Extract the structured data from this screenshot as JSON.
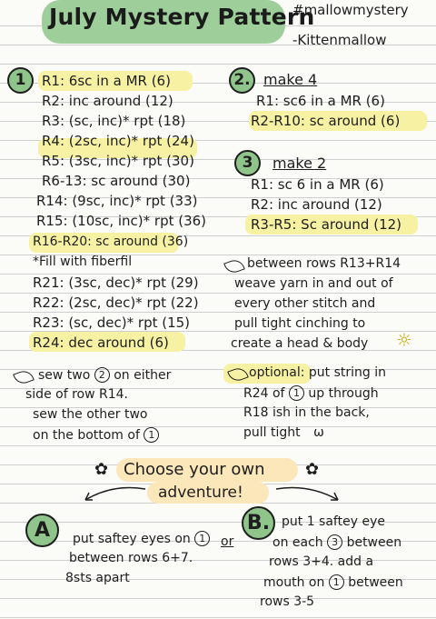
{
  "header": {
    "title": "July Mystery Pattern",
    "hashtag": "#mallowmystery",
    "author": "-Kittenmallow"
  },
  "part1": {
    "number": "1",
    "rows": [
      "R1: 6sc in a MR (6)",
      "R2: inc around (12)",
      "R3: (sc, inc)* rpt (18)",
      "R4: (2sc, inc)* rpt (24)",
      "R5: (3sc, inc)* rpt (30)",
      "R6-13: sc around (30)",
      "R14: (9sc, inc)* rpt (33)",
      "R15: (10sc, inc)* rpt (36)",
      "R16-R20: sc around (36)",
      "*Fill with fiberfil",
      "R21: (3sc, dec)* rpt (29)",
      "R22: (2sc, dec)* rpt (22)",
      "R23: (sc, dec)* rpt (15)",
      "R24: dec around (6)"
    ]
  },
  "part2": {
    "number": "2.",
    "heading": "make 4",
    "rows": [
      "R1: sc6 in a MR (6)",
      "R2-R10: sc around (6)"
    ]
  },
  "part3": {
    "number": "3",
    "heading": "make 2",
    "rows": [
      "R1: sc 6 in a MR (6)",
      "R2: inc around (12)",
      "R3-R5: Sc around (12)"
    ]
  },
  "note_head": {
    "lines": [
      "between rows R13+R14",
      "weave yarn in and out of",
      "every other stitch and",
      "pull tight cinching to",
      "create a head & body"
    ]
  },
  "note_sew": {
    "line1_pre": "sew two",
    "line1_circ": "2",
    "line1_post": "on either",
    "line2": "side of row R14.",
    "line3": "sew the other two",
    "line4_pre": "on the bottom of",
    "line4_circ": "1"
  },
  "note_optional": {
    "line1": "optional: put string in",
    "line2_pre": "R24 of",
    "line2_circ": "1",
    "line2_post": "up through",
    "line3": "R18 ish in the back,",
    "line4": "pull tight",
    "line4_doodle": "ω"
  },
  "adventure": {
    "line1": "Choose your own",
    "line2": "adventure!",
    "or": "or"
  },
  "option_a": {
    "letter": "A",
    "line1_pre": "put saftey eyes on",
    "line1_circ": "1",
    "line2": "between rows 6+7.",
    "line3": "8sts apart"
  },
  "option_b": {
    "letter": "B.",
    "line1": "put 1 saftey eye",
    "line2_pre": "on each",
    "line2_circ": "3",
    "line2_post": "between",
    "line3": "rows 3+4. add a",
    "line4_pre": "mouth on",
    "line4_circ": "1",
    "line4_post": "between",
    "line5": "rows 3-5"
  },
  "icons": {
    "leaf": "leaf-icon",
    "sun": "sun-icon",
    "flower": "flower-icon",
    "arrow": "curved-arrow-icon"
  },
  "colors": {
    "green": "#9ecf9a",
    "yellow": "#f7f2a3",
    "peach": "#fbe7b9"
  }
}
